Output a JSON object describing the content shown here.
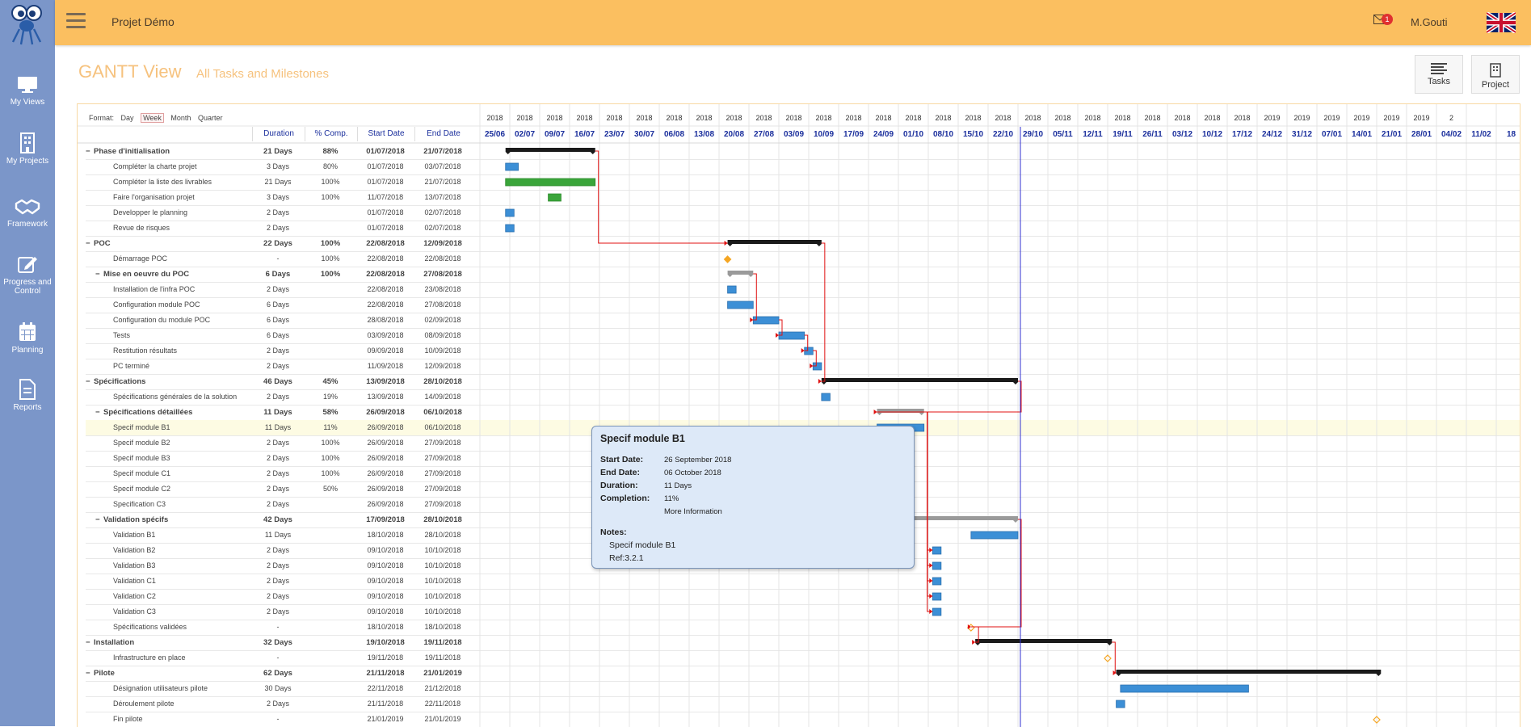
{
  "app": {
    "project_name": "Projet Démo",
    "user_name": "M.Gouti",
    "notification_count": "1"
  },
  "sidebar": {
    "items": [
      {
        "label": "My Views",
        "icon": "monitor-icon"
      },
      {
        "label": "My Projects",
        "icon": "building-icon"
      },
      {
        "label": "Framework",
        "icon": "handshake-icon"
      },
      {
        "label": "Progress and Control",
        "icon": "edit-icon"
      },
      {
        "label": "Planning",
        "icon": "calendar-icon"
      },
      {
        "label": "Reports",
        "icon": "document-icon"
      }
    ]
  },
  "page": {
    "title": "GANTT View",
    "subtitle": "All Tasks and Milestones"
  },
  "actions": {
    "tasks_label": "Tasks",
    "project_label": "Project"
  },
  "format": {
    "label": "Format:",
    "options": [
      "Day",
      "Week",
      "Month",
      "Quarter"
    ],
    "selected": "Week"
  },
  "columns": {
    "duration": "Duration",
    "completion": "% Comp.",
    "start": "Start Date",
    "end": "End Date"
  },
  "timeline": {
    "years": [
      "2018",
      "2018",
      "2018",
      "2018",
      "2018",
      "2018",
      "2018",
      "2018",
      "2018",
      "2018",
      "2018",
      "2018",
      "2018",
      "2018",
      "2018",
      "2018",
      "2018",
      "2018",
      "2018",
      "2018",
      "2018",
      "2018",
      "2018",
      "2018",
      "2018",
      "2018",
      "2019",
      "2019",
      "2019",
      "2019",
      "2019",
      "2019",
      "2"
    ],
    "weeks": [
      "25/06",
      "02/07",
      "09/07",
      "16/07",
      "23/07",
      "30/07",
      "06/08",
      "13/08",
      "20/08",
      "27/08",
      "03/09",
      "10/09",
      "17/09",
      "24/09",
      "01/10",
      "08/10",
      "15/10",
      "22/10",
      "29/10",
      "05/11",
      "12/11",
      "19/11",
      "26/11",
      "03/12",
      "10/12",
      "17/12",
      "24/12",
      "31/12",
      "07/01",
      "14/01",
      "21/01",
      "28/01",
      "04/02",
      "11/02",
      "18"
    ]
  },
  "tasks": [
    {
      "name": "Phase d'initialisation",
      "duration": "21 Days",
      "completion": "88%",
      "start": "01/07/2018",
      "end": "21/07/2018",
      "level": 0,
      "summary": true,
      "collapse": "−"
    },
    {
      "name": "Compléter la charte projet",
      "duration": "3 Days",
      "completion": "80%",
      "start": "01/07/2018",
      "end": "03/07/2018",
      "level": 1
    },
    {
      "name": "Compléter la liste des livrables",
      "duration": "21 Days",
      "completion": "100%",
      "start": "01/07/2018",
      "end": "21/07/2018",
      "level": 1
    },
    {
      "name": "Faire l'organisation projet",
      "duration": "3 Days",
      "completion": "100%",
      "start": "11/07/2018",
      "end": "13/07/2018",
      "level": 1
    },
    {
      "name": "Developper le planning",
      "duration": "2 Days",
      "completion": "",
      "start": "01/07/2018",
      "end": "02/07/2018",
      "level": 1
    },
    {
      "name": "Revue de risques",
      "duration": "2 Days",
      "completion": "",
      "start": "01/07/2018",
      "end": "02/07/2018",
      "level": 1
    },
    {
      "name": "POC",
      "duration": "22 Days",
      "completion": "100%",
      "start": "22/08/2018",
      "end": "12/09/2018",
      "level": 0,
      "summary": true,
      "collapse": "−"
    },
    {
      "name": "Démarrage POC",
      "duration": "-",
      "completion": "100%",
      "start": "22/08/2018",
      "end": "22/08/2018",
      "level": 1
    },
    {
      "name": "Mise en oeuvre du POC",
      "duration": "6 Days",
      "completion": "100%",
      "start": "22/08/2018",
      "end": "27/08/2018",
      "level": 1,
      "summary": true,
      "collapse": "−"
    },
    {
      "name": "Installation de l'infra POC",
      "duration": "2 Days",
      "completion": "",
      "start": "22/08/2018",
      "end": "23/08/2018",
      "level": 2
    },
    {
      "name": "Configuration module POC",
      "duration": "6 Days",
      "completion": "",
      "start": "22/08/2018",
      "end": "27/08/2018",
      "level": 2
    },
    {
      "name": "Configuration du module POC",
      "duration": "6 Days",
      "completion": "",
      "start": "28/08/2018",
      "end": "02/09/2018",
      "level": 1
    },
    {
      "name": "Tests",
      "duration": "6 Days",
      "completion": "",
      "start": "03/09/2018",
      "end": "08/09/2018",
      "level": 1
    },
    {
      "name": "Restitution résultats",
      "duration": "2 Days",
      "completion": "",
      "start": "09/09/2018",
      "end": "10/09/2018",
      "level": 1
    },
    {
      "name": "PC terminé",
      "duration": "2 Days",
      "completion": "",
      "start": "11/09/2018",
      "end": "12/09/2018",
      "level": 1
    },
    {
      "name": "Spécifications",
      "duration": "46 Days",
      "completion": "45%",
      "start": "13/09/2018",
      "end": "28/10/2018",
      "level": 0,
      "summary": true,
      "collapse": "−"
    },
    {
      "name": "Spécifications générales de la solution",
      "duration": "2 Days",
      "completion": "19%",
      "start": "13/09/2018",
      "end": "14/09/2018",
      "level": 1
    },
    {
      "name": "Spécifications détaillées",
      "duration": "11 Days",
      "completion": "58%",
      "start": "26/09/2018",
      "end": "06/10/2018",
      "level": 1,
      "summary": true,
      "collapse": "−"
    },
    {
      "name": "Specif module B1",
      "duration": "11 Days",
      "completion": "11%",
      "start": "26/09/2018",
      "end": "06/10/2018",
      "level": 2,
      "highlight": true
    },
    {
      "name": "Specif module B2",
      "duration": "2 Days",
      "completion": "100%",
      "start": "26/09/2018",
      "end": "27/09/2018",
      "level": 2
    },
    {
      "name": "Specif module B3",
      "duration": "2 Days",
      "completion": "100%",
      "start": "26/09/2018",
      "end": "27/09/2018",
      "level": 2
    },
    {
      "name": "Specif module C1",
      "duration": "2 Days",
      "completion": "100%",
      "start": "26/09/2018",
      "end": "27/09/2018",
      "level": 2
    },
    {
      "name": "Specif module C2",
      "duration": "2 Days",
      "completion": "50%",
      "start": "26/09/2018",
      "end": "27/09/2018",
      "level": 2
    },
    {
      "name": "Specification C3",
      "duration": "2 Days",
      "completion": "",
      "start": "26/09/2018",
      "end": "27/09/2018",
      "level": 2
    },
    {
      "name": "Validation spécifs",
      "duration": "42 Days",
      "completion": "",
      "start": "17/09/2018",
      "end": "28/10/2018",
      "level": 1,
      "summary": true,
      "collapse": "−"
    },
    {
      "name": "Validation B1",
      "duration": "11 Days",
      "completion": "",
      "start": "18/10/2018",
      "end": "28/10/2018",
      "level": 2
    },
    {
      "name": "Validation B2",
      "duration": "2 Days",
      "completion": "",
      "start": "09/10/2018",
      "end": "10/10/2018",
      "level": 2
    },
    {
      "name": "Validation B3",
      "duration": "2 Days",
      "completion": "",
      "start": "09/10/2018",
      "end": "10/10/2018",
      "level": 2
    },
    {
      "name": "Validation C1",
      "duration": "2 Days",
      "completion": "",
      "start": "09/10/2018",
      "end": "10/10/2018",
      "level": 2
    },
    {
      "name": "Validation C2",
      "duration": "2 Days",
      "completion": "",
      "start": "09/10/2018",
      "end": "10/10/2018",
      "level": 2
    },
    {
      "name": "Validation C3",
      "duration": "2 Days",
      "completion": "",
      "start": "09/10/2018",
      "end": "10/10/2018",
      "level": 2
    },
    {
      "name": "Spécifications validées",
      "duration": "-",
      "completion": "",
      "start": "18/10/2018",
      "end": "18/10/2018",
      "level": 1
    },
    {
      "name": "Installation",
      "duration": "32 Days",
      "completion": "",
      "start": "19/10/2018",
      "end": "19/11/2018",
      "level": 0,
      "summary": true,
      "collapse": "−"
    },
    {
      "name": "Infrastructure en place",
      "duration": "-",
      "completion": "",
      "start": "19/11/2018",
      "end": "19/11/2018",
      "level": 1
    },
    {
      "name": "Pilote",
      "duration": "62 Days",
      "completion": "",
      "start": "21/11/2018",
      "end": "21/01/2019",
      "level": 0,
      "summary": true,
      "collapse": "−"
    },
    {
      "name": "Désignation utilisateurs pilote",
      "duration": "30 Days",
      "completion": "",
      "start": "22/11/2018",
      "end": "21/12/2018",
      "level": 1
    },
    {
      "name": "Déroulement pilote",
      "duration": "2 Days",
      "completion": "",
      "start": "21/11/2018",
      "end": "22/11/2018",
      "level": 1
    },
    {
      "name": "Fin pilote",
      "duration": "-",
      "completion": "",
      "start": "21/01/2019",
      "end": "21/01/2019",
      "level": 1
    }
  ],
  "tooltip": {
    "title": "Specif module B1",
    "start_label": "Start Date:",
    "start_value": "26 September 2018",
    "end_label": "End Date:",
    "end_value": "06 October 2018",
    "duration_label": "Duration:",
    "duration_value": "11 Days",
    "completion_label": "Completion:",
    "completion_value": "11%",
    "more_info": "More Information",
    "notes_label": "Notes:",
    "notes_line1": "Specif module B1",
    "notes_line2": "Ref:3.2.1"
  },
  "colors": {
    "topbar": "#fbbf60",
    "sidebar": "#7b96c9",
    "task_bar": "#3c8fd6",
    "done_bar": "#3aa53a",
    "summary_bar": "#1a1a1a",
    "link": "#e01010",
    "today_line": "#2f2fd0",
    "milestone": "#f5a623"
  }
}
